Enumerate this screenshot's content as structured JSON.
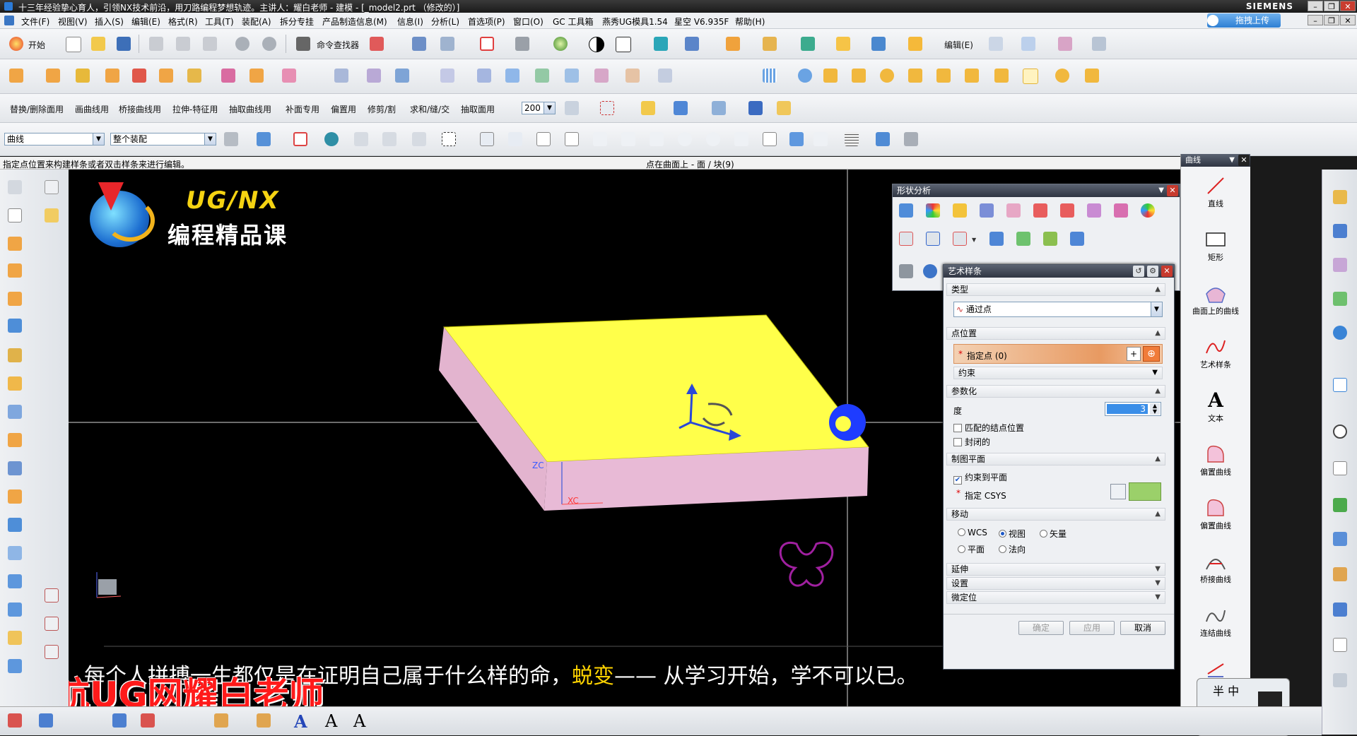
{
  "window": {
    "title": "十三年经验挚心育人，引领NX技术前沿，用刀路编程梦想轨迹。主讲人：耀白老师 - 建模 - [_model2.prt （修改的）]",
    "brand": "SIEMENS"
  },
  "menu": {
    "items": [
      "文件(F)",
      "视图(V)",
      "插入(S)",
      "编辑(E)",
      "格式(R)",
      "工具(T)",
      "装配(A)",
      "拆分专挂",
      "产品制造信息(M)",
      "信息(I)",
      "分析(L)",
      "首选项(P)",
      "窗口(O)",
      "GC 工具箱",
      "燕秀UG模具1.54",
      "星空 V6.935F",
      "帮助(H)"
    ],
    "upload_label": "拖拽上传"
  },
  "toolbar1": {
    "start_label": "开始",
    "cmd_finder_label": "命令查找器",
    "edit_label": "编辑(E)"
  },
  "toolbar3": {
    "labels": [
      "替换/删除面用",
      "画曲线用",
      "桥接曲线用",
      "拉伸-特征用",
      "抽取曲线用",
      "补面专用",
      "偏置用",
      "修剪/割",
      "求和/缝/交",
      "抽取面用"
    ],
    "zoom_value": "200"
  },
  "selection": {
    "filter_value": "曲线",
    "scope_value": "整个装配"
  },
  "status": {
    "prompt": "指定点位置来构建样条或者双击样条来进行编辑。",
    "snap_info": "点在曲面上 - 面 / 块(9)"
  },
  "viewport": {
    "logo_line1": "UG/NX",
    "logo_line2": "编程精品课",
    "axis_zc": "ZC",
    "axis_xc": "XC",
    "subtitle_before": "每个人拼搏一生都仅是在证明自己属于什么样的命，",
    "subtitle_highlight": "蜕变",
    "subtitle_after": "—— 从学习开始，学不可以已。",
    "watermark": "星航UG网耀白老师"
  },
  "shape_panel": {
    "title": "形状分析"
  },
  "dialog": {
    "title": "艺术样条",
    "sec_type": "类型",
    "type_value": "通过点",
    "sec_point": "点位置",
    "specify_point": "指定点 (0)",
    "constraint": "约束",
    "sec_param": "参数化",
    "degree_label": "度",
    "degree_value": "3",
    "match_knots": "匹配的结点位置",
    "closed": "封闭的",
    "sec_plane": "制图平面",
    "constrain_to_plane": "约束到平面",
    "specify_csys": "指定 CSYS",
    "sec_move": "移动",
    "move_options": [
      "WCS",
      "视图",
      "矢量",
      "平面",
      "法向"
    ],
    "move_selected": "视图",
    "sec_extend": "延伸",
    "sec_settings": "设置",
    "sec_fine": "微定位",
    "ok": "确定",
    "apply": "应用",
    "cancel": "取消"
  },
  "right_panel": {
    "title": "曲线",
    "items": [
      "直线",
      "矩形",
      "曲面上的曲线",
      "艺术样条",
      "文本",
      "偏置曲线",
      "偏置曲线",
      "桥接曲线",
      "连结曲线"
    ]
  },
  "avatar_text": "半 中",
  "colors": {
    "block_top": "#ffff4a",
    "block_side": "#e6b8d4",
    "accent_blue": "#1e3cff",
    "subtitle_highlight": "#ffd400",
    "watermark": "#ff1a1a"
  }
}
